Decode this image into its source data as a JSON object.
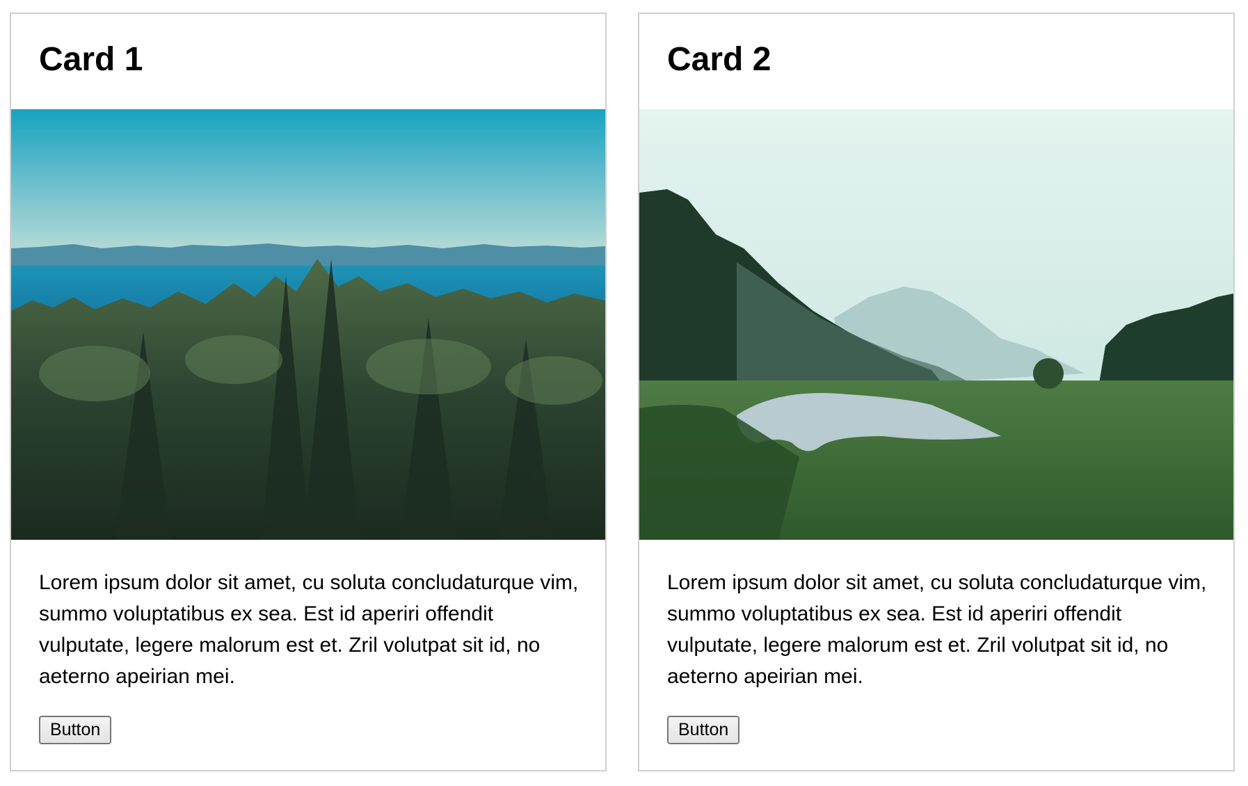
{
  "cards": [
    {
      "title": "Card 1",
      "image_name": "forest-sea-landscape-image",
      "text": "Lorem ipsum dolor sit amet, cu soluta concludaturque vim, summo voluptatibus ex sea. Est id aperiri offendit vulputate, legere malorum est et. Zril volutpat sit id, no aeterno apeirian mei.",
      "button_label": "Button"
    },
    {
      "title": "Card 2",
      "image_name": "misty-valley-river-image",
      "text": "Lorem ipsum dolor sit amet, cu soluta concludaturque vim, summo voluptatibus ex sea. Est id aperiri offendit vulputate, legere malorum est et. Zril volutpat sit id, no aeterno apeirian mei.",
      "button_label": "Button"
    }
  ],
  "colors": {
    "card_border": "#cfcfcf",
    "sky_blue": "#4fb6cc",
    "sea_blue": "#1a8fb0",
    "forest_dark": "#1f3524",
    "mist_sky": "#e4f4ef",
    "meadow_green": "#3f6b34"
  }
}
